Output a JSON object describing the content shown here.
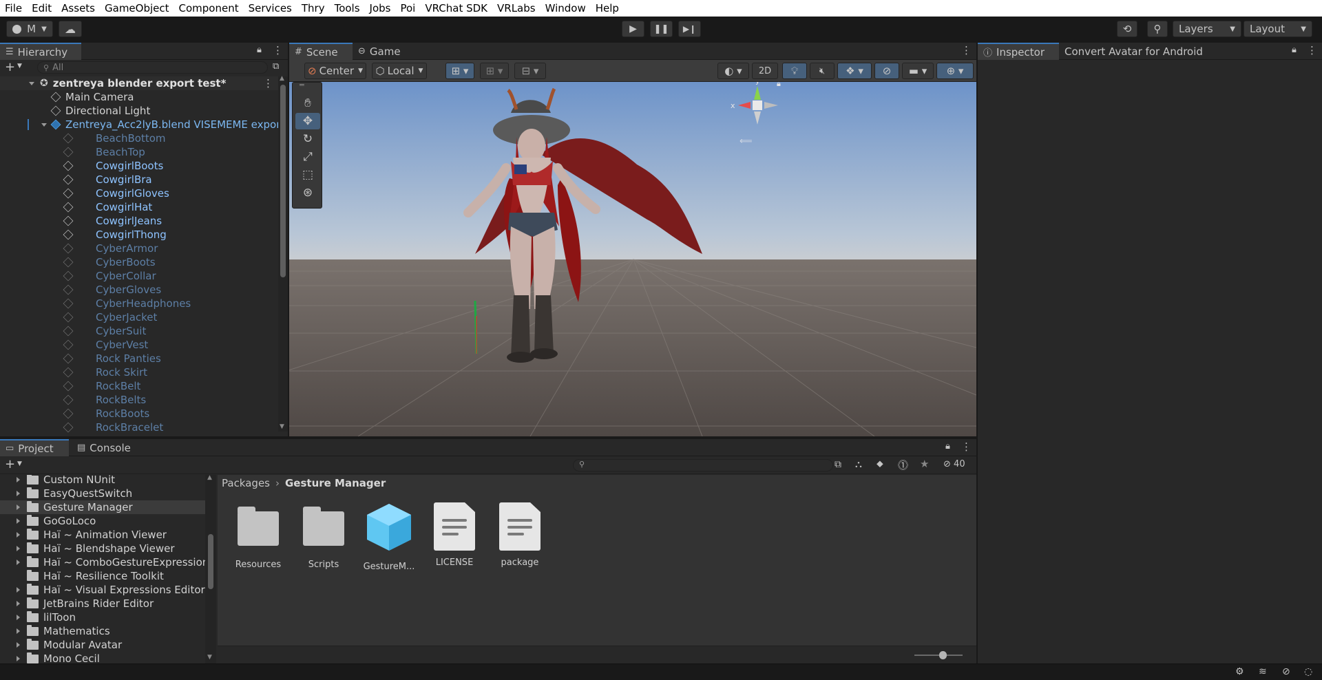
{
  "menu": [
    "File",
    "Edit",
    "Assets",
    "GameObject",
    "Component",
    "Services",
    "Thry",
    "Tools",
    "Jobs",
    "Poi",
    "VRChat SDK",
    "VRLabs",
    "Window",
    "Help"
  ],
  "toolbar": {
    "account_label": "M",
    "layers_label": "Layers",
    "layout_label": "Layout",
    "play_icon": "play-icon",
    "pause_icon": "pause-icon",
    "step_icon": "step-icon"
  },
  "hierarchy": {
    "tab": "Hierarchy",
    "search_placeholder": "All",
    "scene_name": "zentreya blender export test*",
    "objects": [
      {
        "name": "Main Camera",
        "style": "normal"
      },
      {
        "name": "Directional Light",
        "style": "normal"
      },
      {
        "name": "Zentreya_Acc2lyB.blend VISEMEME expor",
        "style": "prefab"
      },
      {
        "name": "BeachBottom",
        "style": "inactive"
      },
      {
        "name": "BeachTop",
        "style": "inactive"
      },
      {
        "name": "CowgirlBoots",
        "style": "active"
      },
      {
        "name": "CowgirlBra",
        "style": "active"
      },
      {
        "name": "CowgirlGloves",
        "style": "active"
      },
      {
        "name": "CowgirlHat",
        "style": "active"
      },
      {
        "name": "CowgirlJeans",
        "style": "active"
      },
      {
        "name": "CowgirlThong",
        "style": "active"
      },
      {
        "name": "CyberArmor",
        "style": "inactive"
      },
      {
        "name": "CyberBoots",
        "style": "inactive"
      },
      {
        "name": "CyberCollar",
        "style": "inactive"
      },
      {
        "name": "CyberGloves",
        "style": "inactive"
      },
      {
        "name": "CyberHeadphones",
        "style": "inactive"
      },
      {
        "name": "CyberJacket",
        "style": "inactive"
      },
      {
        "name": "CyberSuit",
        "style": "inactive"
      },
      {
        "name": "CyberVest",
        "style": "inactive"
      },
      {
        "name": "Rock Panties",
        "style": "inactive"
      },
      {
        "name": "Rock Skirt",
        "style": "inactive"
      },
      {
        "name": "RockBelt",
        "style": "inactive"
      },
      {
        "name": "RockBelts",
        "style": "inactive"
      },
      {
        "name": "RockBoots",
        "style": "inactive"
      },
      {
        "name": "RockBracelet",
        "style": "inactive"
      }
    ]
  },
  "scene": {
    "tabs": [
      "Scene",
      "Game"
    ],
    "pivot_label": "Center",
    "space_label": "Local",
    "mode_2d": "2D",
    "gizmo_axes": {
      "y": "y",
      "x": "x"
    }
  },
  "inspector": {
    "tabs": [
      "Inspector",
      "Convert Avatar for Android"
    ]
  },
  "project": {
    "tabs": [
      "Project",
      "Console"
    ],
    "hidden_count": "40",
    "breadcrumb": [
      "Packages",
      "Gesture Manager"
    ],
    "folders": [
      "Custom NUnit",
      "EasyQuestSwitch",
      "Gesture Manager",
      "GoGoLoco",
      "Haï ~ Animation Viewer",
      "Haï ~ Blendshape Viewer",
      "Haï ~ ComboGestureExpressions",
      "Haï ~ Resilience Toolkit",
      "Haï ~ Visual Expressions Editor",
      "JetBrains Rider Editor",
      "lilToon",
      "Mathematics",
      "Modular Avatar",
      "Mono Cecil"
    ],
    "folder_expandable": [
      true,
      true,
      true,
      true,
      true,
      true,
      true,
      false,
      true,
      true,
      true,
      true,
      true,
      true
    ],
    "selected_folder_index": 2,
    "assets": [
      {
        "label": "Resources",
        "kind": "folder"
      },
      {
        "label": "Scripts",
        "kind": "folder"
      },
      {
        "label": "GestureM...",
        "kind": "prefab"
      },
      {
        "label": "LICENSE",
        "kind": "document"
      },
      {
        "label": "package",
        "kind": "document"
      }
    ]
  },
  "colors": {
    "accent": "#3a79bb",
    "active_text": "#8ec3ff",
    "inactive_text": "#5d7fa6",
    "sky_top": "#6d93c9",
    "ground": "#5a524f"
  }
}
